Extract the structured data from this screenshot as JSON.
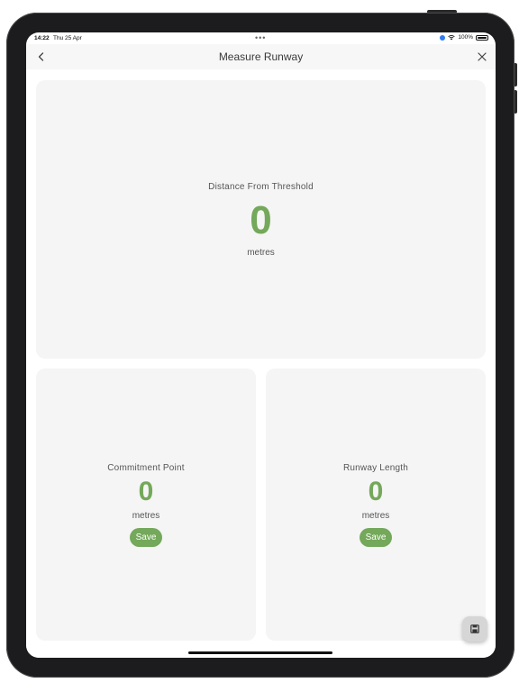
{
  "status_bar": {
    "time": "14:22",
    "date": "Thu 25 Apr",
    "dots": "•••",
    "battery": "100%"
  },
  "nav": {
    "title": "Measure Runway",
    "back_icon": "chevron-left-icon",
    "close_icon": "close-icon"
  },
  "distance_card": {
    "label": "Distance From Threshold",
    "value": "0",
    "unit": "metres"
  },
  "commitment_card": {
    "label": "Commitment Point",
    "value": "0",
    "unit": "metres",
    "save_label": "Save"
  },
  "runway_length_card": {
    "label": "Runway Length",
    "value": "0",
    "unit": "metres",
    "save_label": "Save"
  },
  "fab": {
    "icon": "save-icon"
  },
  "colors": {
    "accent": "#74a85a",
    "card_bg": "#f5f5f5",
    "nav_bg": "#f7f7f7"
  }
}
